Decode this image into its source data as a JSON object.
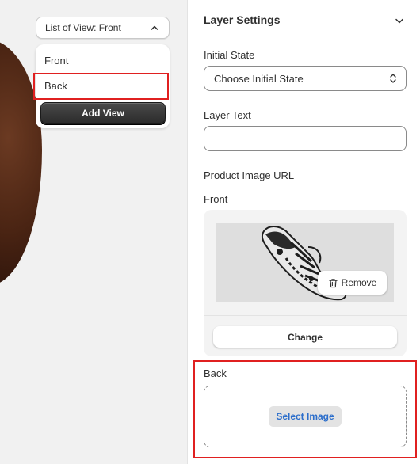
{
  "view_selector": {
    "current_label": "List of View: Front",
    "views": [
      "Front",
      "Back"
    ],
    "add_view_label": "Add View"
  },
  "layer_settings": {
    "title": "Layer Settings",
    "initial_state_label": "Initial State",
    "initial_state_value": "Choose Initial State",
    "layer_text_label": "Layer Text",
    "layer_text_value": "",
    "product_image_url_label": "Product Image URL",
    "front": {
      "label": "Front",
      "remove_label": "Remove",
      "change_label": "Change"
    },
    "back": {
      "label": "Back",
      "select_image_label": "Select Image"
    }
  },
  "icons": [
    "chevron-up-icon",
    "chevron-down-icon",
    "select-updown-icon",
    "trash-icon"
  ],
  "colors": {
    "highlight": "#e02020",
    "link_blue": "#2c6ecb",
    "button_dark": "#303030"
  }
}
